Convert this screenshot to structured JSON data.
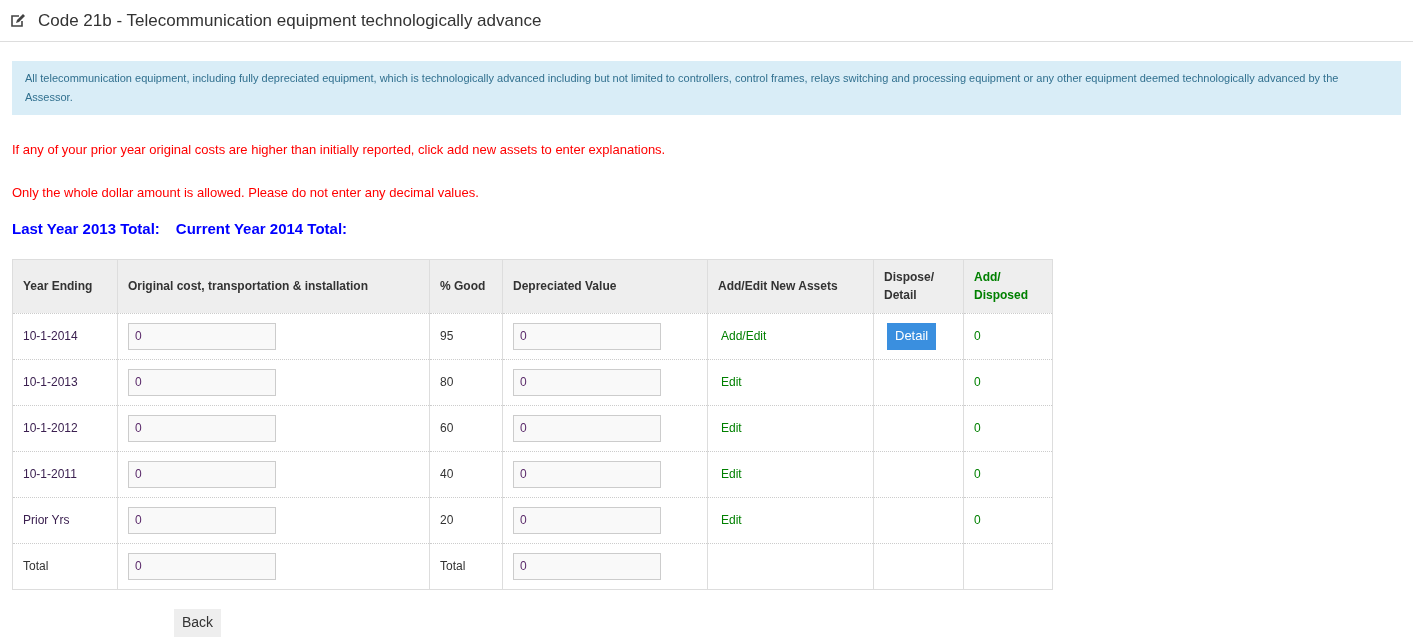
{
  "page_title": "Code 21b - Telecommunication equipment technologically advance",
  "info": "All telecommunication equipment, including fully depreciated equipment, which is technologically advanced including but not limited to controllers, control frames, relays switching and processing equipment or any other equipment deemed technologically advanced by the Assessor.",
  "warnings": [
    "If any of your prior year original costs are higher than initially reported, click add new assets to enter explanations.",
    "Only the whole dollar amount is allowed. Please do not enter any decimal values."
  ],
  "totals_heading": [
    "Last Year 2013 Total:",
    "Current Year 2014 Total:"
  ],
  "table": {
    "columns": [
      "Year Ending",
      "Original cost, transportation & installation",
      "% Good",
      "Depreciated Value",
      "Add/Edit New Assets",
      "Dispose/ Detail",
      "Add/ Disposed"
    ],
    "rows": [
      {
        "kind": "year",
        "year": "10-1-2014",
        "original_cost": "0",
        "good": "95",
        "depreciated": "0",
        "action": "Add/Edit",
        "detail": "Detail",
        "added_disposed": "0"
      },
      {
        "kind": "year",
        "year": "10-1-2013",
        "original_cost": "0",
        "good": "80",
        "depreciated": "0",
        "action": "Edit",
        "added_disposed": "0"
      },
      {
        "kind": "year",
        "year": "10-1-2012",
        "original_cost": "0",
        "good": "60",
        "depreciated": "0",
        "action": "Edit",
        "added_disposed": "0"
      },
      {
        "kind": "year",
        "year": "10-1-2011",
        "original_cost": "0",
        "good": "40",
        "depreciated": "0",
        "action": "Edit",
        "added_disposed": "0"
      },
      {
        "kind": "year",
        "year": "Prior Yrs",
        "original_cost": "0",
        "good": "20",
        "depreciated": "0",
        "action": "Edit",
        "added_disposed": "0"
      },
      {
        "kind": "total",
        "year": "Total",
        "original_cost": "0",
        "good": "Total",
        "depreciated": "0"
      }
    ]
  },
  "back_button": "Back"
}
